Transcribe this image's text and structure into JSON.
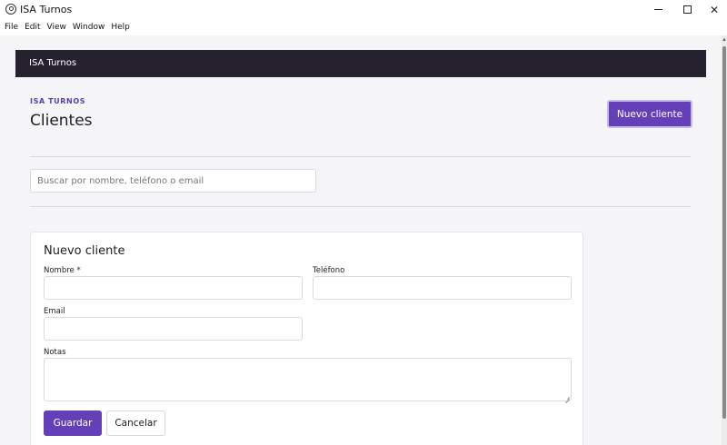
{
  "window": {
    "title": "ISA Turnos",
    "minimize_glyph": "",
    "maximize_glyph": "",
    "close_glyph": "✕"
  },
  "menu": [
    "File",
    "Edit",
    "View",
    "Window",
    "Help"
  ],
  "navbar": {
    "brand": "ISA Turnos"
  },
  "header": {
    "eyebrow": "ISA TURNOS",
    "title": "Clientes",
    "new_client_button": "Nuevo cliente"
  },
  "search": {
    "placeholder": "Buscar por nombre, teléfono o email"
  },
  "form": {
    "title": "Nuevo cliente",
    "fields": {
      "nombre_label": "Nombre *",
      "nombre_value": "",
      "telefono_label": "Teléfono",
      "telefono_value": "",
      "email_label": "Email",
      "email_value": "",
      "notas_label": "Notas",
      "notas_value": ""
    },
    "save_button": "Guardar",
    "cancel_button": "Cancelar"
  },
  "icons": {
    "app": "app-logo-icon",
    "resize": "resize-grip-icon"
  },
  "colors": {
    "accent": "#6340b8",
    "navbar": "#25212f",
    "background": "#f5f5f8"
  }
}
